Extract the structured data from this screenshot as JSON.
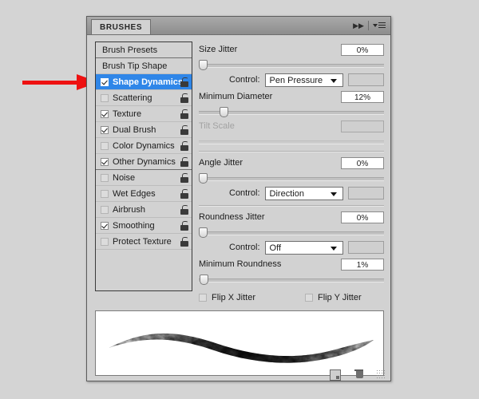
{
  "panel": {
    "tab_label": "BRUSHES",
    "collapse_icon": "double-chevron-right-icon",
    "menu_icon": "panel-menu-icon"
  },
  "brush_list": [
    {
      "label": "Brush Presets",
      "type": "plain",
      "checkbox": null,
      "selected": false,
      "lock": true,
      "separator_after": true
    },
    {
      "label": "Brush Tip Shape",
      "type": "plain",
      "checkbox": null,
      "selected": false,
      "lock": false,
      "separator_after": false
    },
    {
      "label": "Shape Dynamics",
      "type": "check",
      "checkbox": true,
      "selected": true,
      "lock": true,
      "separator_after": false
    },
    {
      "label": "Scattering",
      "type": "check",
      "checkbox": false,
      "selected": false,
      "lock": true,
      "separator_after": false
    },
    {
      "label": "Texture",
      "type": "check",
      "checkbox": true,
      "selected": false,
      "lock": true,
      "separator_after": false
    },
    {
      "label": "Dual Brush",
      "type": "check",
      "checkbox": true,
      "selected": false,
      "lock": true,
      "separator_after": false
    },
    {
      "label": "Color Dynamics",
      "type": "check",
      "checkbox": false,
      "selected": false,
      "lock": true,
      "separator_after": false
    },
    {
      "label": "Other Dynamics",
      "type": "check",
      "checkbox": true,
      "selected": false,
      "lock": true,
      "separator_after": true
    },
    {
      "label": "Noise",
      "type": "check",
      "checkbox": false,
      "selected": false,
      "lock": true,
      "separator_after": false
    },
    {
      "label": "Wet Edges",
      "type": "check",
      "checkbox": false,
      "selected": false,
      "lock": true,
      "separator_after": false
    },
    {
      "label": "Airbrush",
      "type": "check",
      "checkbox": false,
      "selected": false,
      "lock": true,
      "separator_after": false
    },
    {
      "label": "Smoothing",
      "type": "check",
      "checkbox": true,
      "selected": false,
      "lock": true,
      "separator_after": false
    },
    {
      "label": "Protect Texture",
      "type": "check",
      "checkbox": false,
      "selected": false,
      "lock": true,
      "separator_after": false
    }
  ],
  "controls": {
    "size_jitter": {
      "label": "Size Jitter",
      "value": "0%",
      "slider_pct": 0
    },
    "size_control": {
      "label": "Control:",
      "value": "Pen Pressure"
    },
    "minimum_diameter": {
      "label": "Minimum Diameter",
      "value": "12%",
      "slider_pct": 12
    },
    "tilt_scale": {
      "label": "Tilt Scale",
      "value": "",
      "slider_pct": 0,
      "disabled": true
    },
    "angle_jitter": {
      "label": "Angle Jitter",
      "value": "0%",
      "slider_pct": 0
    },
    "angle_control": {
      "label": "Control:",
      "value": "Direction"
    },
    "roundness_jitter": {
      "label": "Roundness Jitter",
      "value": "0%",
      "slider_pct": 0
    },
    "roundness_control": {
      "label": "Control:",
      "value": "Off"
    },
    "minimum_roundness": {
      "label": "Minimum Roundness",
      "value": "1%",
      "slider_pct": 1
    },
    "flip_x": {
      "label": "Flip X Jitter",
      "checked": false
    },
    "flip_y": {
      "label": "Flip Y Jitter",
      "checked": false
    }
  },
  "footer": {
    "new_brush_icon": "new-brush-icon",
    "delete_brush_icon": "trash-icon",
    "resize_grip_icon": "resize-grip-icon"
  },
  "annotation": {
    "arrow_color": "#ee1111",
    "points_at": "Shape Dynamics"
  },
  "colors": {
    "selection_blue": "#2f86e8",
    "panel_bg": "#d2d2d2",
    "desktop_bg": "#d4d4d4"
  }
}
